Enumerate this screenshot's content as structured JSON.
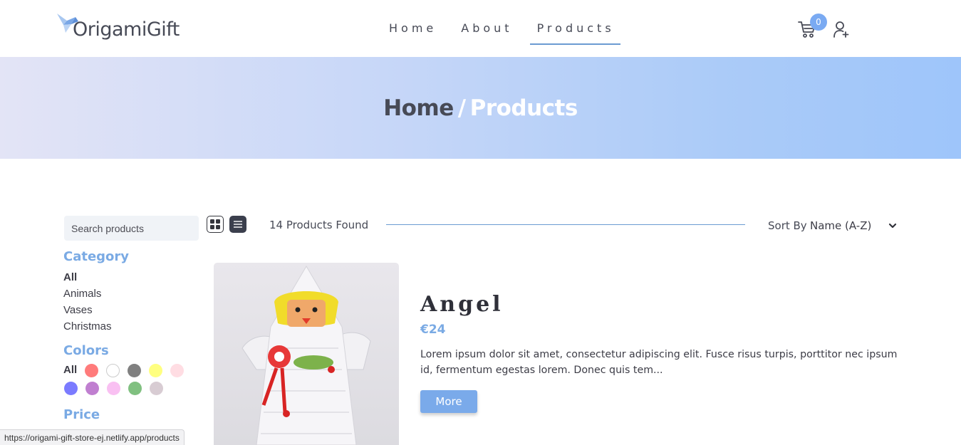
{
  "brand": {
    "name": "OrigamiGift",
    "accent": "#7aaae4"
  },
  "nav": {
    "links": [
      {
        "label": "Home"
      },
      {
        "label": "About"
      },
      {
        "label": "Products",
        "active": true
      }
    ],
    "cart_count": "0"
  },
  "hero": {
    "home": "Home",
    "separator": "/",
    "current": "Products"
  },
  "filters": {
    "search_placeholder": "Search products",
    "category_heading": "Category",
    "categories": [
      "All",
      "Animals",
      "Vases",
      "Christmas"
    ],
    "colors_heading": "Colors",
    "colors_all": "All",
    "colors": [
      "#ff7b7b",
      "#ffffff",
      "#808080",
      "#ffff80",
      "#ffdde3",
      "#7b7bff",
      "#c07fd0",
      "#f9c0f2",
      "#80c080",
      "#d8ccd3"
    ],
    "price_heading": "Price"
  },
  "toolbar": {
    "found": "14 Products Found",
    "sort_label": "Sort By",
    "sort_value": "Name (A-Z)"
  },
  "product": {
    "name": "Angel",
    "price": "€24",
    "description": "Lorem ipsum dolor sit amet, consectetur adipiscing elit. Fusce risus turpis, porttitor nec ipsum id, fermentum egestas lorem. Donec quis tem...",
    "more_label": "More"
  },
  "status_url": "https://origami-gift-store-ej.netlify.app/products"
}
